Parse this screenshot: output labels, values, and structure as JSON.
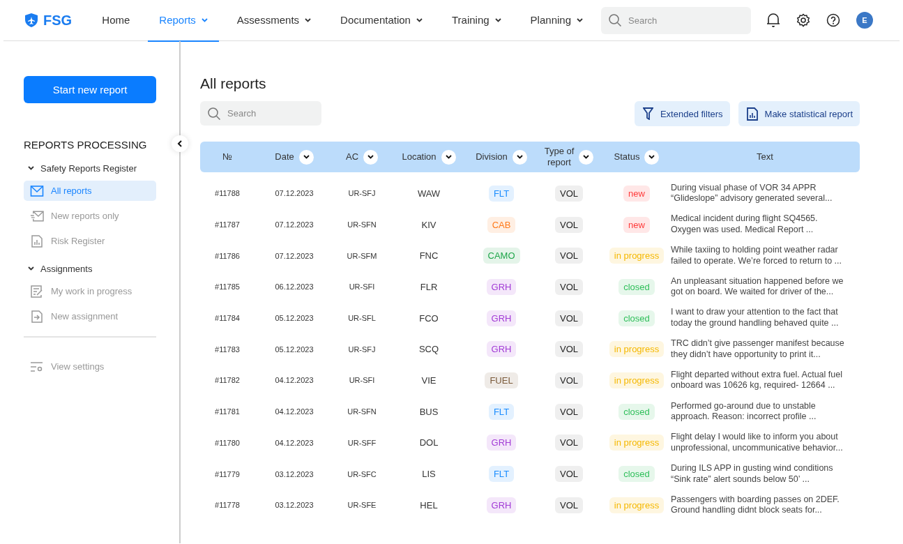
{
  "brand": "FSG",
  "nav": [
    {
      "label": "Home",
      "selected": false,
      "dropdown": false
    },
    {
      "label": "Reports",
      "selected": true,
      "dropdown": true
    },
    {
      "label": "Assessments",
      "selected": false,
      "dropdown": true
    },
    {
      "label": "Documentation",
      "selected": false,
      "dropdown": true
    },
    {
      "label": "Training",
      "selected": false,
      "dropdown": true
    },
    {
      "label": "Planning",
      "selected": false,
      "dropdown": true
    }
  ],
  "header_search": {
    "placeholder": "Search"
  },
  "avatar": "E",
  "sidebar": {
    "primary_button": "Start new report",
    "section_title": "REPORTS PROCESSING",
    "groups": [
      {
        "label": "Safety Reports Register",
        "expanded": true,
        "children": [
          {
            "label": "All reports",
            "selected": true
          },
          {
            "label": "New reports only",
            "selected": false
          },
          {
            "label": "Risk Register",
            "selected": false
          }
        ]
      },
      {
        "label": "Assignments",
        "expanded": true,
        "children": [
          {
            "label": "My work in progress",
            "selected": false
          },
          {
            "label": "New assignment",
            "selected": false
          }
        ]
      }
    ],
    "footer_item": "View settings"
  },
  "page_title": "All reports",
  "search": {
    "placeholder": "Search"
  },
  "actions": [
    "Extended filters",
    "Make statistical report"
  ],
  "table": {
    "columns": [
      {
        "label": "№",
        "sortable": false
      },
      {
        "label": "Date",
        "sortable": true
      },
      {
        "label": "AC",
        "sortable": true
      },
      {
        "label": "Location",
        "sortable": true
      },
      {
        "label": "Division",
        "sortable": true
      },
      {
        "label": "Type of\nreport",
        "sortable": true
      },
      {
        "label": "Status",
        "sortable": true
      },
      {
        "label": "Text",
        "sortable": false
      }
    ],
    "rows": [
      {
        "id": "#11788",
        "date": "07.12.2023",
        "ac": "UR-SFJ",
        "location": "WAW",
        "division": {
          "label": "FLT",
          "color": "#1a8cff"
        },
        "type": "VOL",
        "status": {
          "label": "new",
          "color": "#ff3b3b"
        },
        "text": "During visual phase of VOR 34 APPR\n“Glideslope” advisory generated several..."
      },
      {
        "id": "#11787",
        "date": "07.12.2023",
        "ac": "UR-SFN",
        "location": "KIV",
        "division": {
          "label": "CAB",
          "color": "#ff7a1a"
        },
        "type": "VOL",
        "status": {
          "label": "new",
          "color": "#ff3b3b"
        },
        "text": "Medical incident during flight SQ4565.\nOxygen was used. Medical Report ..."
      },
      {
        "id": "#11786",
        "date": "07.12.2023",
        "ac": "UR-SFM",
        "location": "FNC",
        "division": {
          "label": "CAMO",
          "color": "#1fa64a"
        },
        "type": "VOL",
        "status": {
          "label": "in progress",
          "color": "#f5b800"
        },
        "text": "While taxiing to holding point weather radar\nfailed to operate. We’re forced to return to ..."
      },
      {
        "id": "#11785",
        "date": "06.12.2023",
        "ac": "UR-SFI",
        "location": "FLR",
        "division": {
          "label": "GRH",
          "color": "#a23bd6"
        },
        "type": "VOL",
        "status": {
          "label": "closed",
          "color": "#2fbf5a"
        },
        "text": "An unpleasant situation happened before we\ngot on board. We waited for driver of the..."
      },
      {
        "id": "#11784",
        "date": "05.12.2023",
        "ac": "UR-SFL",
        "location": "FCO",
        "division": {
          "label": "GRH",
          "color": "#a23bd6"
        },
        "type": "VOL",
        "status": {
          "label": "closed",
          "color": "#2fbf5a"
        },
        "text": "I want to draw your attention to the fact that\ntoday the ground handling behaved quite ..."
      },
      {
        "id": "#11783",
        "date": "05.12.2023",
        "ac": "UR-SFJ",
        "location": "SCQ",
        "division": {
          "label": "GRH",
          "color": "#a23bd6"
        },
        "type": "VOL",
        "status": {
          "label": "in progress",
          "color": "#f5b800"
        },
        "text": "TRC didn’t give passenger manifest because\nthey didn’t have opportunity to print it..."
      },
      {
        "id": "#11782",
        "date": "04.12.2023",
        "ac": "UR-SFI",
        "location": "VIE",
        "division": {
          "label": "FUEL",
          "color": "#7a5a3a"
        },
        "type": "VOL",
        "status": {
          "label": "in progress",
          "color": "#f5b800"
        },
        "text": "Flight departed without extra fuel. Actual fuel\nonboard was 10626 kg, required- 12664 ..."
      },
      {
        "id": "#11781",
        "date": "04.12.2023",
        "ac": "UR-SFN",
        "location": "BUS",
        "division": {
          "label": "FLT",
          "color": "#1a8cff"
        },
        "type": "VOL",
        "status": {
          "label": "closed",
          "color": "#2fbf5a"
        },
        "text": "Performed go-around due to unstable\napproach. Reason: incorrect profile ..."
      },
      {
        "id": "#11780",
        "date": "04.12.2023",
        "ac": "UR-SFF",
        "location": "DOL",
        "division": {
          "label": "GRH",
          "color": "#a23bd6"
        },
        "type": "VOL",
        "status": {
          "label": "in progress",
          "color": "#f5b800"
        },
        "text": "Flight delay I would like to inform you about\nunprofessional, uncommunicative behavior..."
      },
      {
        "id": "#11779",
        "date": "03.12.2023",
        "ac": "UR-SFC",
        "location": "LIS",
        "division": {
          "label": "FLT",
          "color": "#1a8cff"
        },
        "type": "VOL",
        "status": {
          "label": "closed",
          "color": "#2fbf5a"
        },
        "text": "During ILS APP in gusting wind conditions\n“Sink rate” alert sounds below 50’ ..."
      },
      {
        "id": "#11778",
        "date": "03.12.2023",
        "ac": "UR-SFE",
        "location": "HEL",
        "division": {
          "label": "GRH",
          "color": "#a23bd6"
        },
        "type": "VOL",
        "status": {
          "label": "in progress",
          "color": "#f5b800"
        },
        "text": "Passengers with boarding passes on 2DEF.\nGround handling didnt block seats for..."
      }
    ]
  }
}
